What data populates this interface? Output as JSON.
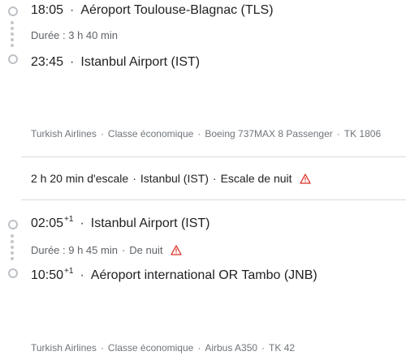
{
  "segments": [
    {
      "depart_time": "18:05",
      "depart_sup": "",
      "depart_airport": "Aéroport Toulouse-Blagnac (TLS)",
      "duration": "Durée : 3 h 40 min",
      "duration_extra": "",
      "arrive_time": "23:45",
      "arrive_sup": "",
      "arrive_airport": "Istanbul Airport (IST)",
      "details": [
        "Turkish Airlines",
        "Classe économique",
        "Boeing 737MAX 8 Passenger",
        "TK 1806"
      ]
    },
    {
      "depart_time": "02:05",
      "depart_sup": "+1",
      "depart_airport": "Istanbul Airport (IST)",
      "duration": "Durée : 9 h 45 min",
      "duration_extra": "De nuit",
      "arrive_time": "10:50",
      "arrive_sup": "+1",
      "arrive_airport": "Aéroport international OR Tambo (JNB)",
      "details": [
        "Turkish Airlines",
        "Classe économique",
        "Airbus A350",
        "TK 42"
      ]
    }
  ],
  "layover": {
    "duration": "2 h 20 min d'escale",
    "place": "Istanbul (IST)",
    "note": "Escale de nuit"
  },
  "icons": {
    "warning": "warning-triangle-icon",
    "warning_color": "#d93025"
  }
}
